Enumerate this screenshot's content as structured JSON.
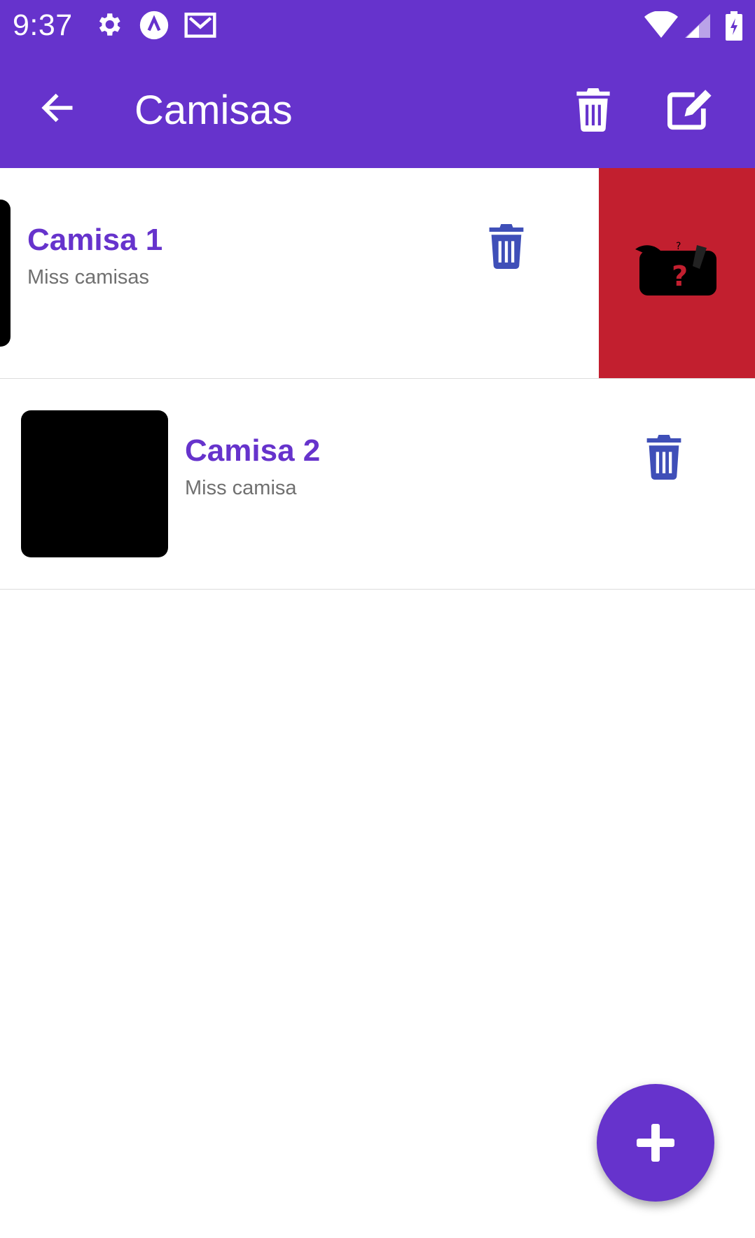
{
  "status_bar": {
    "time": "9:37",
    "left_icons": [
      "gear-icon",
      "app-a-icon",
      "gmail-icon"
    ],
    "right_icons": [
      "wifi-icon",
      "cell-signal-icon",
      "battery-charging-icon"
    ]
  },
  "app_bar": {
    "title": "Camisas",
    "background": "#6633cc",
    "actions": [
      "trash-icon",
      "edit-icon"
    ]
  },
  "items": [
    {
      "title": "Camisa 1",
      "subtitle": "Miss camisas",
      "swiped": true,
      "swipe_action_color": "#c21f2f",
      "swipe_action_icon": "image-error-placeholder-icon"
    },
    {
      "title": "Camisa 2",
      "subtitle": "Miss camisa",
      "swiped": false
    }
  ],
  "fab": {
    "icon": "plus-icon"
  },
  "colors": {
    "primary": "#6633cc",
    "delete_icon": "#3f4fb8",
    "swipe_red": "#c21f2f"
  }
}
